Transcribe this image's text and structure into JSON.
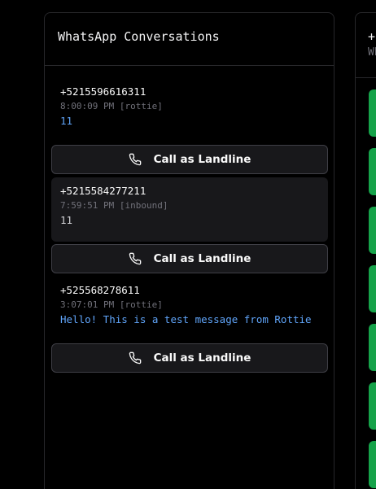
{
  "left_panel": {
    "title": "WhatsApp Conversations",
    "conversations": [
      {
        "phone": "+5215596616311",
        "meta": "8:00:09 PM [rottie]",
        "message": "11",
        "call_label": "Call as Landline"
      },
      {
        "phone": "+5215584277211",
        "meta": "7:59:51 PM [inbound]",
        "message": "11",
        "call_label": "Call as Landline"
      },
      {
        "phone": "+525568278611",
        "meta": "3:07:01 PM [rottie]",
        "message": "Hello! This is a test message from Rottie",
        "call_label": "Call as Landline"
      }
    ]
  },
  "right_panel": {
    "title": "+",
    "subtitle": "Wh"
  },
  "colors": {
    "background": "#000000",
    "border": "#27272a",
    "outbound_message": "#60a5fa",
    "inbound_message": "#d4d4d8",
    "accent_green": "#16a34a"
  }
}
